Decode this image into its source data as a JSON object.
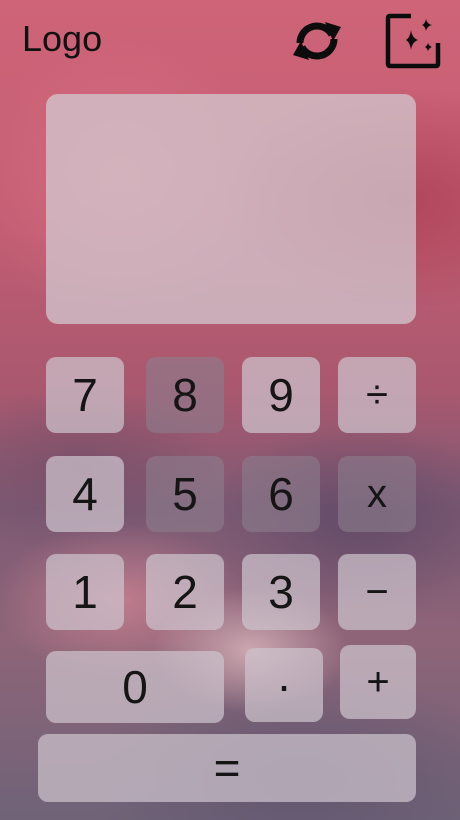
{
  "header": {
    "logo": "Logo",
    "refresh_icon": "refresh-icon",
    "sparkle_icon": "sparkle-image-icon"
  },
  "display": {
    "value": ""
  },
  "keys": {
    "k7": "7",
    "k8": "8",
    "k9": "9",
    "divide": "÷",
    "k4": "4",
    "k5": "5",
    "k6": "6",
    "multiply": "x",
    "k1": "1",
    "k2": "2",
    "k3": "3",
    "subtract": "−",
    "k0": "0",
    "decimal": "·",
    "add": "+",
    "equals": "="
  }
}
